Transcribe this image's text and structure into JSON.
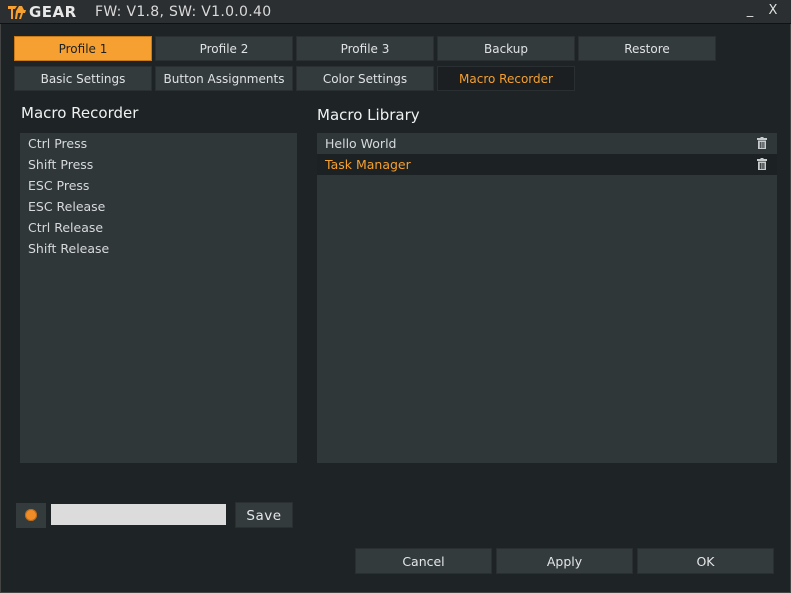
{
  "window": {
    "logo_text": "GEAR",
    "version": "FW: V1.8, SW: V1.0.0.40",
    "minimize_label": "_",
    "close_label": "X"
  },
  "profile_tabs": [
    {
      "label": "Profile 1",
      "active": true
    },
    {
      "label": "Profile 2",
      "active": false
    },
    {
      "label": "Profile 3",
      "active": false
    },
    {
      "label": "Backup",
      "active": false
    },
    {
      "label": "Restore",
      "active": false
    }
  ],
  "section_tabs": [
    {
      "label": "Basic Settings",
      "active": false
    },
    {
      "label": "Button Assignments",
      "active": false
    },
    {
      "label": "Color Settings",
      "active": false
    },
    {
      "label": "Macro Recorder",
      "active": true
    }
  ],
  "recorder": {
    "title": "Macro Recorder",
    "items": [
      "Ctrl Press",
      "Shift Press",
      "ESC Press",
      "ESC Release",
      "Ctrl Release",
      "Shift Release"
    ]
  },
  "library": {
    "title": "Macro Library",
    "items": [
      {
        "label": "Hello World",
        "selected": false,
        "icon": "trash-icon"
      },
      {
        "label": "Task Manager",
        "selected": true,
        "icon": "trash-icon"
      }
    ]
  },
  "save_row": {
    "record_icon": "record-dot-icon",
    "name_value": "",
    "save_label": "Save"
  },
  "footer": {
    "cancel_label": "Cancel",
    "apply_label": "Apply",
    "ok_label": "OK"
  },
  "colors": {
    "accent": "#f5a030",
    "background": "#1e2325",
    "panel": "#303739",
    "button": "#343b3d"
  }
}
